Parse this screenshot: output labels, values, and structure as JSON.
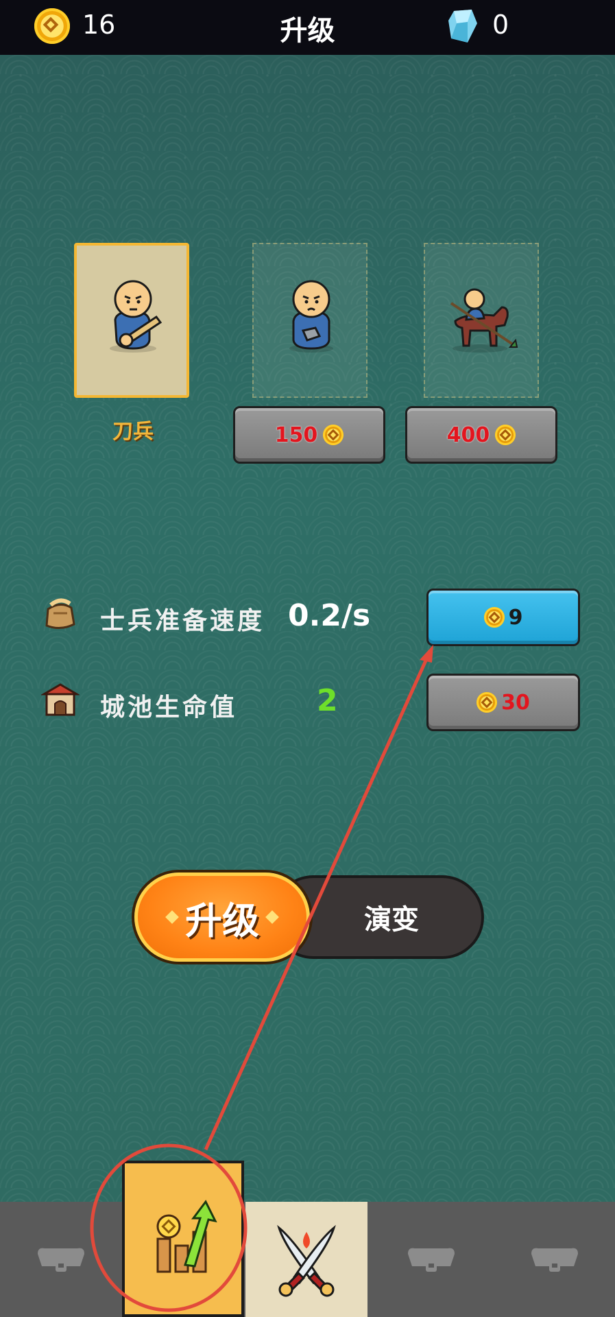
{
  "topbar": {
    "coins": "16",
    "title": "升级",
    "gems": "0"
  },
  "units": [
    {
      "name": "刀兵",
      "state": "owned"
    },
    {
      "price": "150",
      "state": "locked"
    },
    {
      "price": "400",
      "state": "locked"
    }
  ],
  "upgrades": [
    {
      "label": "士兵准备速度",
      "value": "0.2/s",
      "cost": "9",
      "button_color": "#2fb2e4",
      "value_color": "#ffffff",
      "cost_color": "#1a1a1a"
    },
    {
      "label": "城池生命值",
      "value": "2",
      "cost": "30",
      "button_color": "#8a8a8a",
      "value_color": "#6ee02a",
      "cost_color": "#e3151e"
    }
  ],
  "mode_toggle": {
    "active": "升级",
    "inactive": "演变"
  },
  "bottom_nav": {
    "items": [
      {
        "icon": "locked-tab-icon",
        "state": "locked"
      },
      {
        "icon": "upgrade-coin-arrow-icon",
        "state": "active"
      },
      {
        "icon": "crossed-swords-icon",
        "state": "available"
      },
      {
        "icon": "locked-tab-icon",
        "state": "locked"
      },
      {
        "icon": "locked-tab-icon",
        "state": "locked"
      }
    ]
  },
  "colors": {
    "accent_orange": "#ff8316",
    "annotation_red": "#e24a3b",
    "coin_gold": "#f4b733"
  }
}
